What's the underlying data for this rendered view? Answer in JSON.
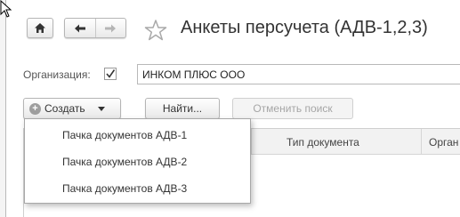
{
  "window": {
    "title": "Анкеты персучета (АДВ-1,2,3)"
  },
  "toolbar": {
    "home_icon": "home-icon",
    "back_icon": "arrow-left-icon",
    "forward_icon": "arrow-right-icon",
    "favorite_icon": "star-icon"
  },
  "filter": {
    "organization_label": "Организация:",
    "organization_checked": true,
    "organization_value": "ИНКОМ ПЛЮС ООО"
  },
  "actions": {
    "create_label": "Создать",
    "find_label": "Найти...",
    "cancel_search_label": "Отменить поиск"
  },
  "create_menu": {
    "items": [
      "Пачка документов АДВ-1",
      "Пачка документов АДВ-2",
      "Пачка документов АДВ-3"
    ]
  },
  "table": {
    "columns": [
      "Тип документа",
      "Орган"
    ]
  }
}
